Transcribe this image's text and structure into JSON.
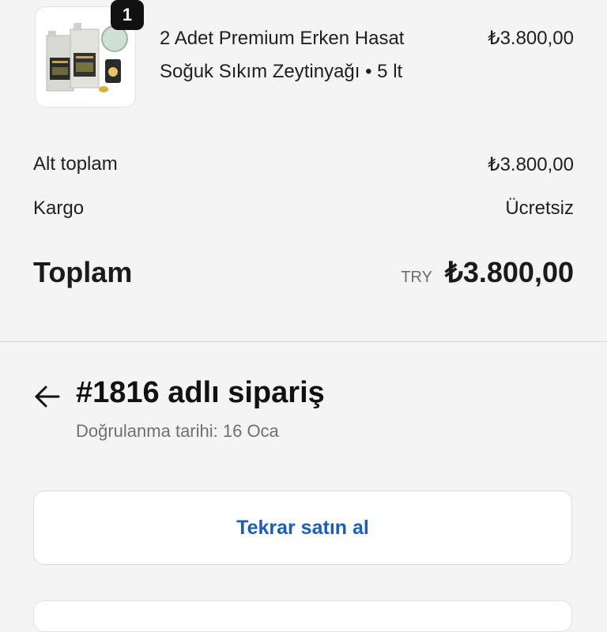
{
  "product": {
    "quantity_badge": "1",
    "title_line1": "2 Adet Premium Erken Hasat",
    "title_line2": "Soğuk Sıkım Zeytinyağı • 5 lt",
    "price": "₺3.800,00"
  },
  "summary": {
    "subtotal_label": "Alt toplam",
    "subtotal_value": "₺3.800,00",
    "shipping_label": "Kargo",
    "shipping_value": "Ücretsiz",
    "total_label": "Toplam",
    "currency": "TRY",
    "total_value": "₺3.800,00"
  },
  "order": {
    "title": "#1816 adlı sipariş",
    "subtitle": "Doğrulanma tarihi: 16 Oca"
  },
  "actions": {
    "buy_again": "Tekrar satın al"
  },
  "icons": {
    "back": "arrow-left-icon",
    "product": "product-image"
  },
  "colors": {
    "background": "#f4f4f4",
    "accent": "#1a5fb4",
    "badge": "#111111"
  }
}
